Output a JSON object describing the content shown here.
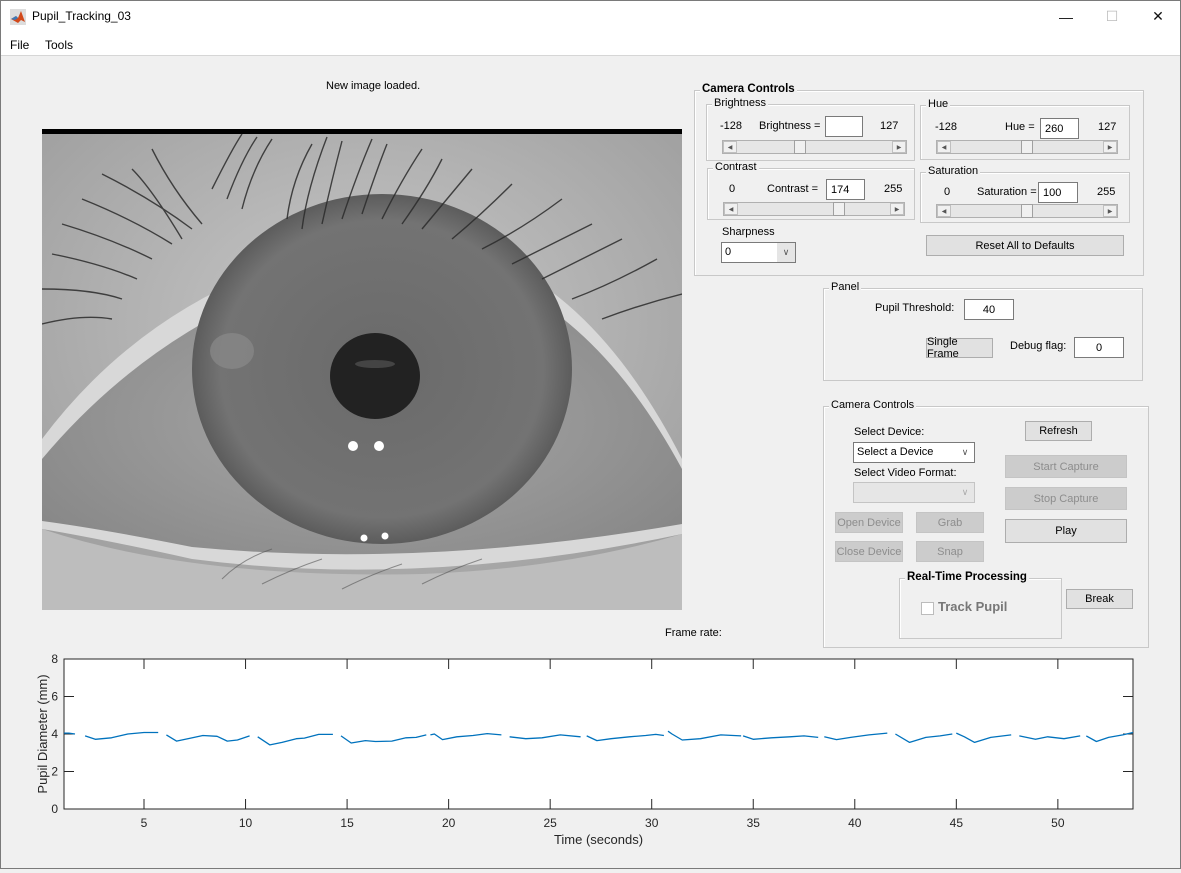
{
  "window": {
    "title": "Pupil_Tracking_03",
    "minimize_icon": "minimize-icon",
    "maximize_icon": "maximize-icon",
    "close_icon": "close-icon"
  },
  "menu": {
    "items": [
      "File",
      "Tools"
    ]
  },
  "status_text": "New image loaded.",
  "frame_rate_label": "Frame rate:",
  "camera_controls_top": {
    "title": "Camera Controls",
    "brightness": {
      "title": "Brightness",
      "min": "-128",
      "max": "127",
      "label": "Brightness =",
      "value": "",
      "slider_fraction": 0.4
    },
    "hue": {
      "title": "Hue",
      "min": "-128",
      "max": "127",
      "label": "Hue =",
      "value": "260",
      "slider_fraction": 0.5
    },
    "contrast": {
      "title": "Contrast",
      "min": "0",
      "max": "255",
      "label": "Contrast =",
      "value": "174",
      "slider_fraction": 0.682
    },
    "saturation": {
      "title": "Saturation",
      "min": "0",
      "max": "255",
      "label": "Saturation =",
      "value": "100",
      "slider_fraction": 0.5
    },
    "sharpness": {
      "label": "Sharpness",
      "value": "0"
    },
    "reset_label": "Reset All to Defaults"
  },
  "panel": {
    "title": "Panel",
    "threshold_label": "Pupil Threshold:",
    "threshold_value": "40",
    "single_frame_label": "Single Frame",
    "debug_label": "Debug flag:",
    "debug_value": "0"
  },
  "camera_controls_bottom": {
    "title": "Camera Controls",
    "select_device_label": "Select Device:",
    "select_device_value": "Select a Device",
    "select_format_label": "Select Video Format:",
    "select_format_value": "",
    "refresh_label": "Refresh",
    "start_capture_label": "Start Capture",
    "stop_capture_label": "Stop Capture",
    "play_label": "Play",
    "open_device_label": "Open Device",
    "close_device_label": "Close Device",
    "grab_label": "Grab",
    "snap_label": "Snap",
    "break_label": "Break",
    "realtime": {
      "title": "Real-Time Processing",
      "track_pupil_label": "Track Pupil",
      "track_pupil_checked": false
    }
  },
  "chart_data": {
    "type": "line",
    "title": "",
    "xlabel": "Time (seconds)",
    "ylabel": "Pupil Diameter (mm)",
    "xlim": [
      1.06,
      53.7
    ],
    "ylim": [
      0,
      8
    ],
    "xticks": [
      5,
      10,
      15,
      20,
      25,
      30,
      35,
      40,
      45,
      50
    ],
    "yticks": [
      0,
      2,
      4,
      6,
      8
    ],
    "grid": false,
    "color": "#0072bd",
    "series": [
      {
        "name": "Pupil Diameter",
        "segments": [
          {
            "x": [
              1.06,
              1.3,
              1.6
            ],
            "y": [
              4.05,
              4.05,
              4.0
            ]
          },
          {
            "x": [
              2.1,
              2.6,
              3.4,
              4.2,
              5.0,
              5.7
            ],
            "y": [
              3.9,
              3.72,
              3.8,
              4.0,
              4.08,
              4.08
            ]
          },
          {
            "x": [
              6.1,
              6.6,
              7.3,
              7.9,
              8.6,
              9.1,
              9.6,
              10.2
            ],
            "y": [
              3.95,
              3.62,
              3.78,
              3.92,
              3.88,
              3.62,
              3.68,
              3.9
            ]
          },
          {
            "x": [
              10.6,
              11.2,
              11.8,
              12.5,
              12.9,
              13.6,
              14.3
            ],
            "y": [
              3.85,
              3.42,
              3.55,
              3.75,
              3.78,
              3.98,
              3.98
            ]
          },
          {
            "x": [
              14.7,
              15.2,
              15.9,
              16.4,
              17.2,
              17.9,
              18.4,
              18.9
            ],
            "y": [
              3.9,
              3.52,
              3.65,
              3.6,
              3.62,
              3.8,
              3.82,
              3.95
            ]
          },
          {
            "x": [
              19.1,
              19.3,
              19.7,
              20.4,
              21.2,
              21.9,
              22.6
            ],
            "y": [
              3.95,
              4.0,
              3.7,
              3.85,
              3.92,
              4.02,
              3.95
            ]
          },
          {
            "x": [
              23.0,
              23.8,
              24.6,
              25.5,
              26.5
            ],
            "y": [
              3.85,
              3.75,
              3.8,
              3.95,
              3.85
            ]
          },
          {
            "x": [
              26.8,
              27.3,
              28.0,
              28.9,
              29.7,
              30.2,
              30.6
            ],
            "y": [
              3.9,
              3.65,
              3.75,
              3.85,
              3.92,
              3.98,
              3.92
            ]
          },
          {
            "x": [
              30.8,
              31.0,
              31.5,
              32.4,
              33.4,
              34.4
            ],
            "y": [
              4.15,
              4.0,
              3.68,
              3.75,
              3.95,
              3.9
            ]
          },
          {
            "x": [
              34.5,
              35.0,
              35.9,
              36.8,
              37.5,
              38.2
            ],
            "y": [
              3.9,
              3.72,
              3.8,
              3.85,
              3.9,
              3.82
            ]
          },
          {
            "x": [
              38.5,
              39.1,
              39.8,
              40.7,
              41.6
            ],
            "y": [
              3.85,
              3.7,
              3.82,
              3.95,
              4.05
            ]
          },
          {
            "x": [
              42.0,
              42.7,
              43.5,
              44.2,
              44.8
            ],
            "y": [
              4.0,
              3.55,
              3.82,
              3.9,
              4.0
            ]
          },
          {
            "x": [
              45.0,
              45.4,
              45.9,
              46.7,
              47.7
            ],
            "y": [
              4.05,
              3.85,
              3.55,
              3.82,
              3.95
            ]
          },
          {
            "x": [
              48.1,
              48.9,
              49.5,
              50.3,
              51.1
            ],
            "y": [
              3.9,
              3.72,
              3.85,
              3.75,
              3.9
            ]
          },
          {
            "x": [
              51.4,
              51.9,
              52.5,
              53.2,
              53.7
            ],
            "y": [
              3.9,
              3.6,
              3.82,
              3.95,
              4.08
            ]
          }
        ]
      }
    ]
  }
}
